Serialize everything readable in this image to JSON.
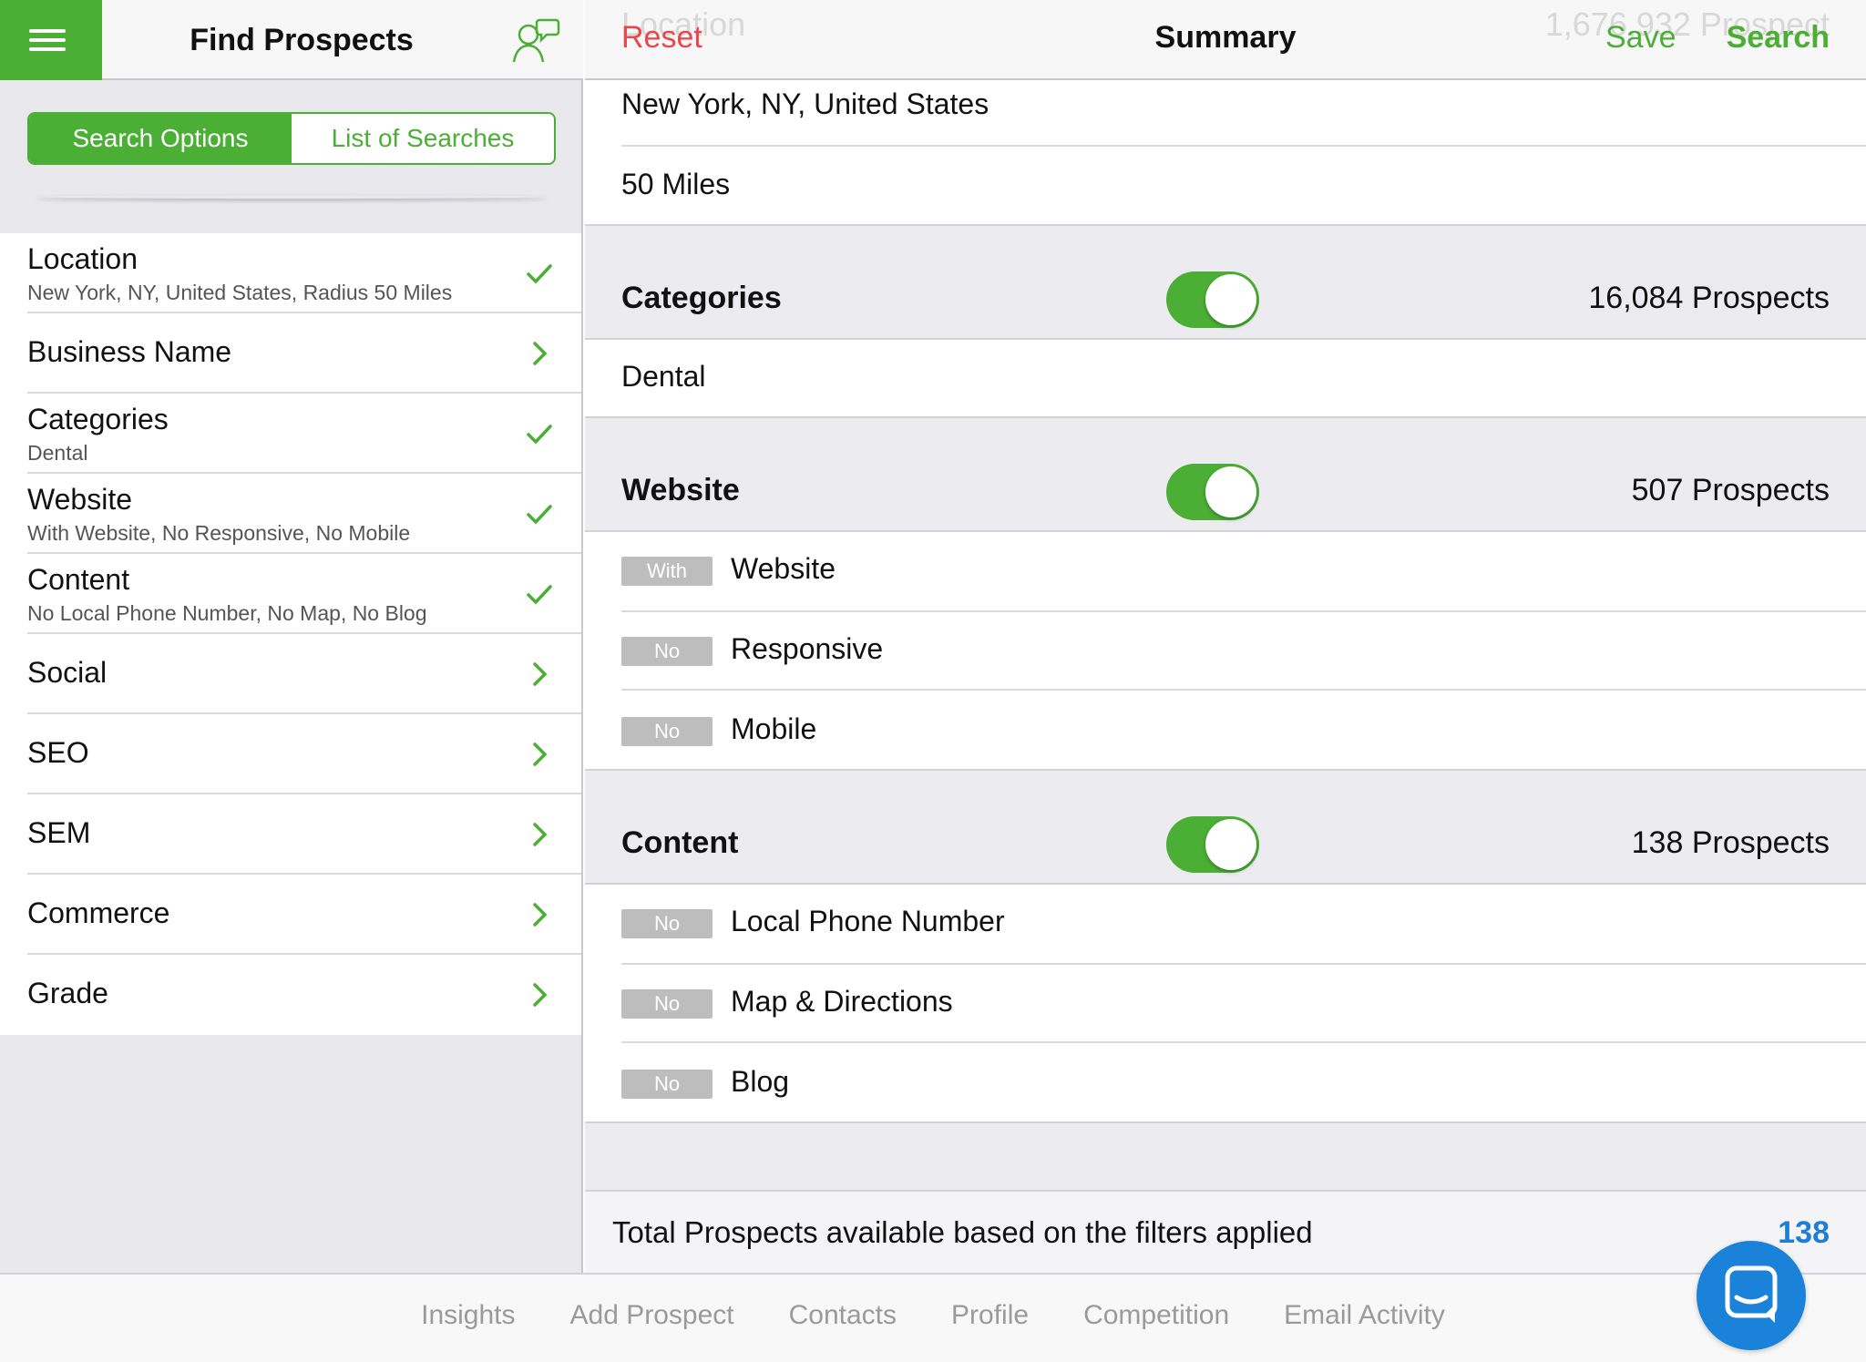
{
  "left_header": {
    "title": "Find Prospects"
  },
  "segments": {
    "search_options": "Search Options",
    "list_of_searches": "List of Searches",
    "active": "search_options"
  },
  "options": [
    {
      "title": "Location",
      "subtitle": "New York, NY, United States, Radius 50 Miles",
      "mark": "check-icon"
    },
    {
      "title": "Business Name",
      "subtitle": "",
      "mark": "chevron-right-icon"
    },
    {
      "title": "Categories",
      "subtitle": "Dental",
      "mark": "check-icon"
    },
    {
      "title": "Website",
      "subtitle": "With Website, No Responsive, No Mobile",
      "mark": "check-icon"
    },
    {
      "title": "Content",
      "subtitle": "No Local Phone Number, No Map, No Blog",
      "mark": "check-icon"
    },
    {
      "title": "Social",
      "subtitle": "",
      "mark": "chevron-right-icon"
    },
    {
      "title": "SEO",
      "subtitle": "",
      "mark": "chevron-right-icon"
    },
    {
      "title": "SEM",
      "subtitle": "",
      "mark": "chevron-right-icon"
    },
    {
      "title": "Commerce",
      "subtitle": "",
      "mark": "chevron-right-icon"
    },
    {
      "title": "Grade",
      "subtitle": "",
      "mark": "chevron-right-icon"
    }
  ],
  "right_header": {
    "reset": "Reset",
    "title": "Summary",
    "save": "Save",
    "search": "Search",
    "ghost_left": "Location",
    "ghost_right": "1,676,932 Prospect"
  },
  "location": {
    "place": "New York, NY, United States",
    "radius": "50 Miles"
  },
  "categories": {
    "title": "Categories",
    "count": "16,084 Prospects",
    "enabled": true,
    "values": [
      "Dental"
    ]
  },
  "website": {
    "title": "Website",
    "count": "507 Prospects",
    "enabled": true,
    "items": [
      {
        "tag": "With",
        "label": "Website"
      },
      {
        "tag": "No",
        "label": "Responsive"
      },
      {
        "tag": "No",
        "label": "Mobile"
      }
    ]
  },
  "content": {
    "title": "Content",
    "count": "138 Prospects",
    "enabled": true,
    "items": [
      {
        "tag": "No",
        "label": "Local Phone Number"
      },
      {
        "tag": "No",
        "label": "Map & Directions"
      },
      {
        "tag": "No",
        "label": "Blog"
      }
    ]
  },
  "total": {
    "label": "Total Prospects available based on the filters applied",
    "value": "138"
  },
  "tabs": [
    "Insights",
    "Add Prospect",
    "Contacts",
    "Profile",
    "Competition",
    "Email Activity"
  ],
  "colors": {
    "accent": "#4caf35",
    "reset": "#e8474c",
    "link": "#1d7fd4",
    "chat": "#1a82d9"
  }
}
